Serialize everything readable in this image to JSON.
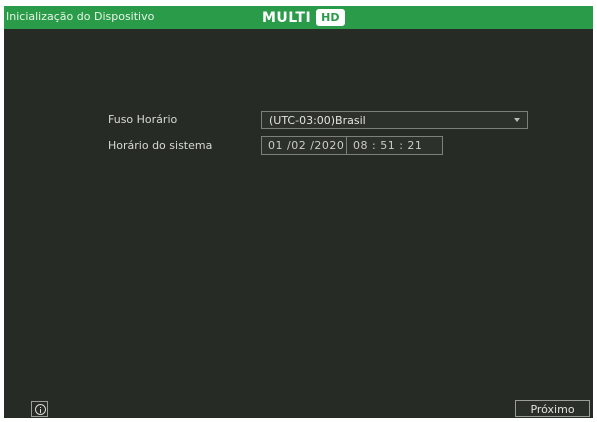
{
  "window": {
    "title": "Inicialização do Dispositivo",
    "logo_text": "MULTI",
    "logo_badge": "HD",
    "accent_color": "#2a9b49",
    "background_color": "#272b26"
  },
  "form": {
    "timezone_label": "Fuso Horário",
    "timezone_value": "(UTC-03:00)Brasil",
    "system_time_label": "Horário do sistema",
    "date_value": "01 /02 /2020",
    "time_value": "08 : 51 : 21"
  },
  "footer": {
    "info_icon": "info-icon",
    "next_label": "Próximo"
  }
}
